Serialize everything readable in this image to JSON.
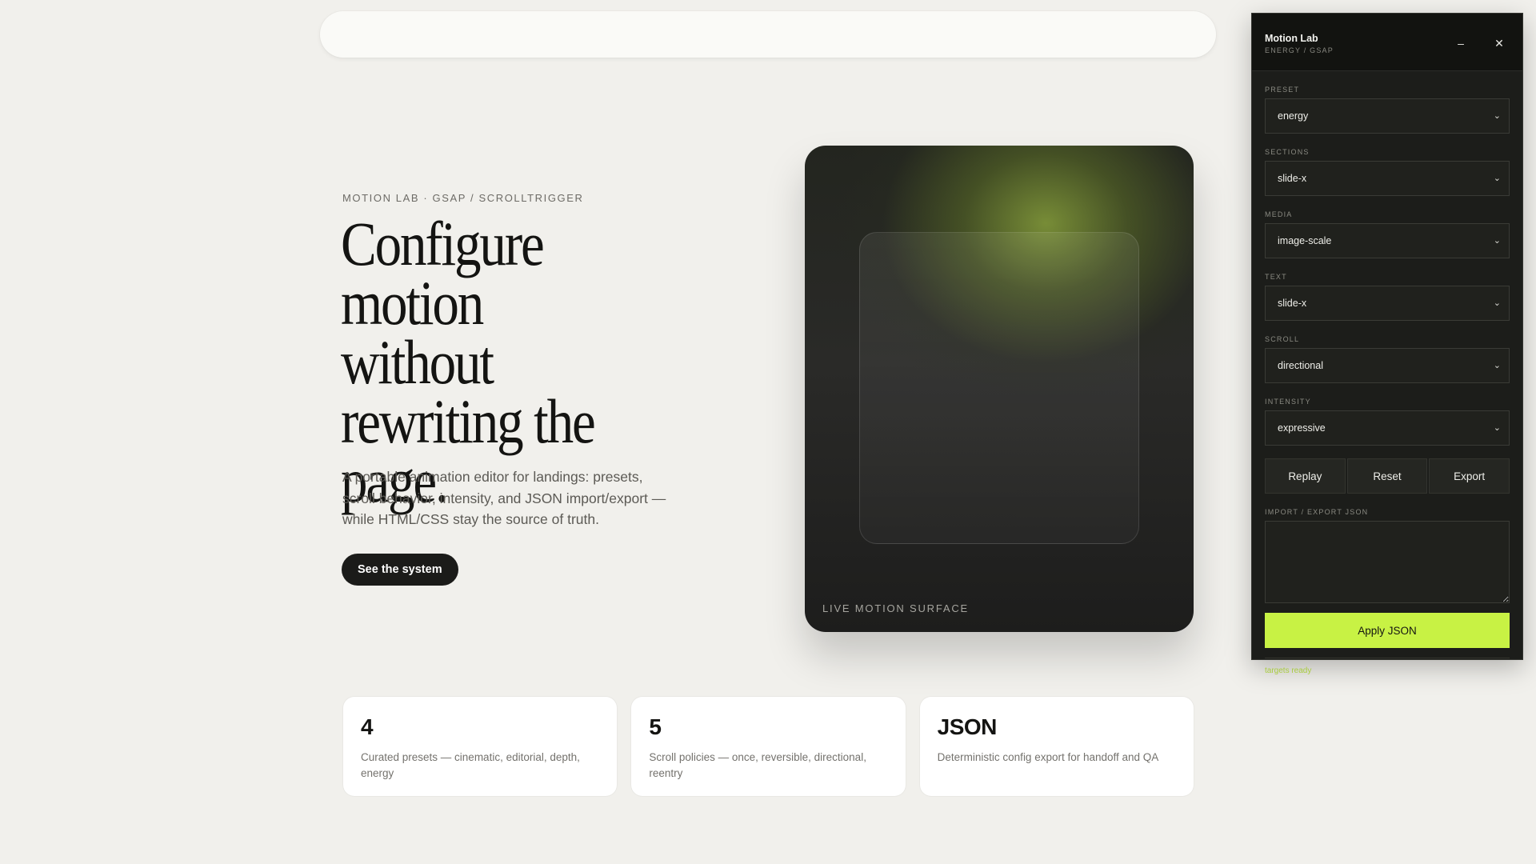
{
  "hero": {
    "eyebrow": "MOTION LAB · GSAP / SCROLLTRIGGER",
    "headline": "Configure motion without rewriting the page.",
    "lede": "A portable animation editor for landings: presets, scroll behavior, intensity, and JSON import/export — while HTML/CSS stay the source of truth.",
    "cta_label": "See the system"
  },
  "surface": {
    "label": "LIVE MOTION SURFACE"
  },
  "stats": [
    {
      "value": "4",
      "description": "Curated presets — cinematic, editorial, depth, energy"
    },
    {
      "value": "5",
      "description": "Scroll policies — once, reversible, directional, reentry"
    },
    {
      "value": "JSON",
      "description": "Deterministic config export for handoff and QA"
    }
  ],
  "panel": {
    "title": "Motion Lab",
    "subtitle": "ENERGY / GSAP",
    "minimize_glyph": "–",
    "close_glyph": "✕",
    "fields": [
      {
        "label": "PRESET",
        "value": "energy"
      },
      {
        "label": "SECTIONS",
        "value": "slide-x"
      },
      {
        "label": "MEDIA",
        "value": "image-scale"
      },
      {
        "label": "TEXT",
        "value": "slide-x"
      },
      {
        "label": "SCROLL",
        "value": "directional"
      },
      {
        "label": "INTENSITY",
        "value": "expressive"
      }
    ],
    "actions": {
      "replay": "Replay",
      "reset": "Reset",
      "export": "Export"
    },
    "json_label": "IMPORT / EXPORT JSON",
    "json_value": "",
    "apply_label": "Apply JSON",
    "status": "targets ready"
  },
  "colors": {
    "page_bg": "#f1f0ec",
    "accent": "#c8f244",
    "status": "#a9cc3f",
    "panel_bg": "#1c1d1a"
  },
  "icons": {
    "minimize": "minimize-icon",
    "close": "close-icon",
    "chevron": "chevron-down-icon"
  }
}
